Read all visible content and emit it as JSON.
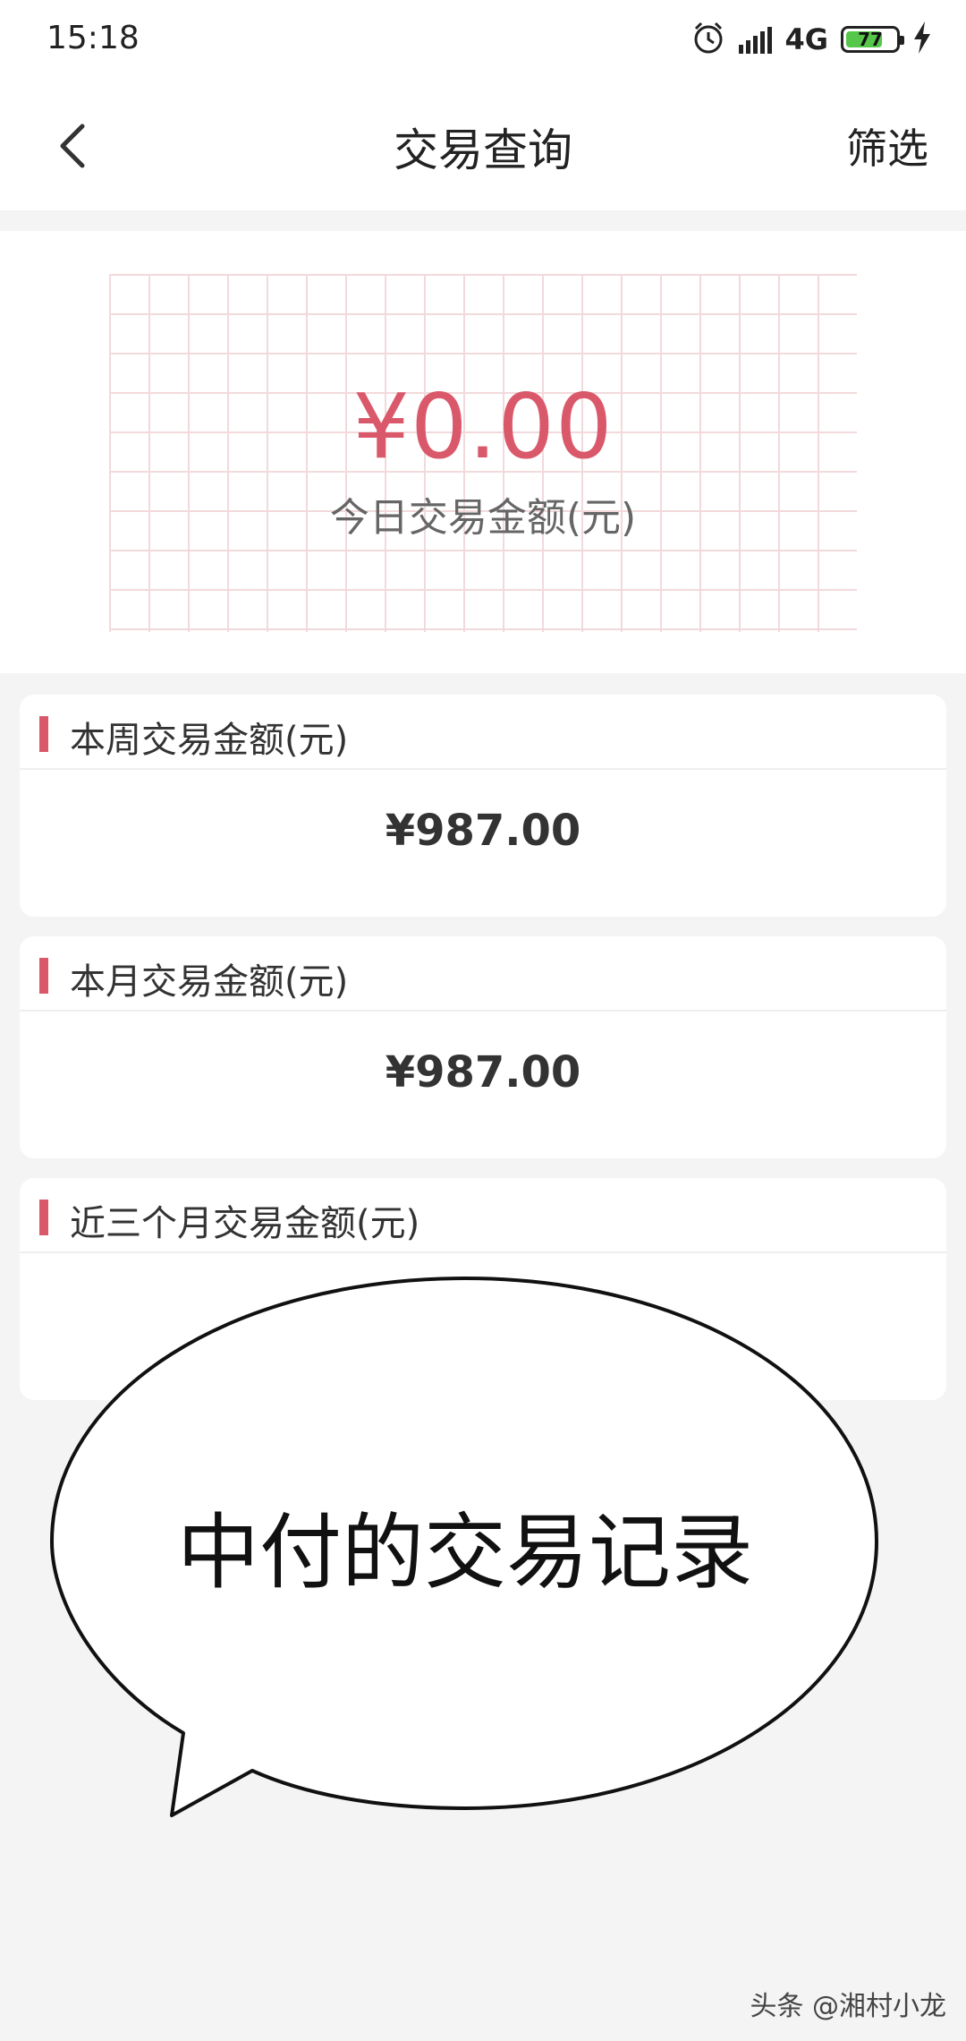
{
  "status_bar": {
    "time": "15:18",
    "network": "4G",
    "battery": "77",
    "battery_level": 0.77,
    "battery_color": "#56c74a"
  },
  "nav": {
    "back_icon": "chevron-left-icon",
    "title": "交易查询",
    "filter_label": "筛选"
  },
  "today": {
    "amount": "¥0.00",
    "label": "今日交易金额(元)",
    "accent_color": "#d9596b"
  },
  "cards": [
    {
      "title": "本周交易金额(元)",
      "value": "¥987.00"
    },
    {
      "title": "本月交易金额(元)",
      "value": "¥987.00"
    },
    {
      "title": "近三个月交易金额(元)",
      "value": ""
    }
  ],
  "overlay": {
    "bubble_text": "中付的交易记录"
  },
  "watermark": "头条 @湘村小龙"
}
